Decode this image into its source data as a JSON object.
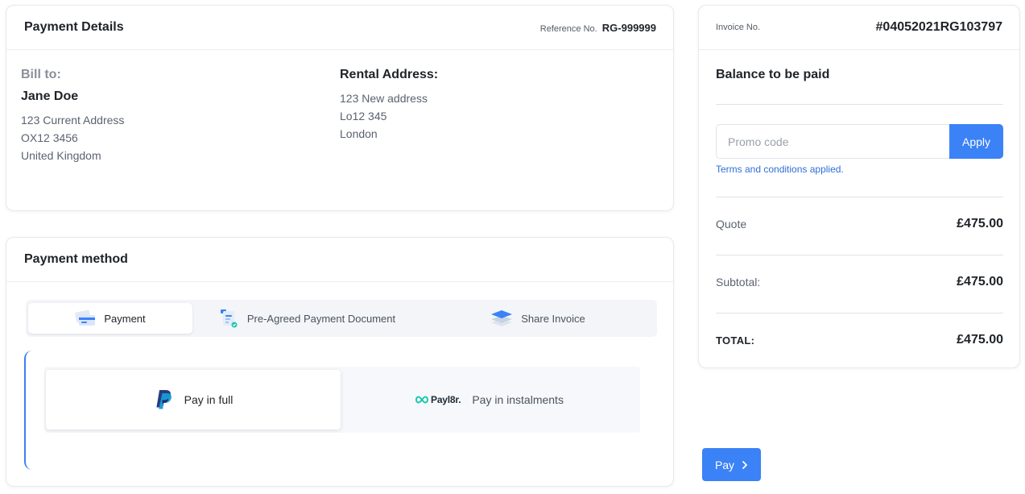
{
  "details": {
    "title": "Payment Details",
    "reference_label": "Reference No.",
    "reference_value": "RG-999999",
    "bill_to": {
      "label": "Bill to:",
      "name": "Jane Doe",
      "lines": [
        "123 Current Address",
        "OX12 3456",
        "United Kingdom"
      ]
    },
    "rental": {
      "label": "Rental Address:",
      "lines": [
        "123 New address",
        "Lo12 345",
        "London"
      ]
    }
  },
  "method": {
    "title": "Payment method",
    "tabs": [
      {
        "label": "Payment",
        "icon": "card-icon",
        "active": true
      },
      {
        "label": "Pre-Agreed Payment Document",
        "icon": "document-icon",
        "active": false
      },
      {
        "label": "Share Invoice",
        "icon": "layers-icon",
        "active": false
      }
    ],
    "options": [
      {
        "label": "Pay in full",
        "logo": "paypal-logo",
        "selected": true
      },
      {
        "label": "Pay in instalments",
        "logo": "payl8r-logo",
        "logo_text": "Payl8r.",
        "selected": false
      }
    ]
  },
  "invoice": {
    "label": "Invoice No.",
    "number": "#04052021RG103797",
    "balance_title": "Balance to be paid",
    "promo_placeholder": "Promo code",
    "promo_value": "",
    "apply_label": "Apply",
    "terms_text": "Terms and conditions applied.",
    "rows": [
      {
        "label": "Quote",
        "value": "£475.00"
      },
      {
        "label": "Subtotal:",
        "value": "£475.00"
      },
      {
        "label": "TOTAL:",
        "value": "£475.00"
      }
    ]
  },
  "pay_button": {
    "label": "Pay",
    "icon": "chevron-right-icon"
  },
  "colors": {
    "accent": "#3b82f6",
    "paypal_dark": "#253b80",
    "paypal_light": "#179bd7",
    "payl8r": "#1ec7b0"
  }
}
